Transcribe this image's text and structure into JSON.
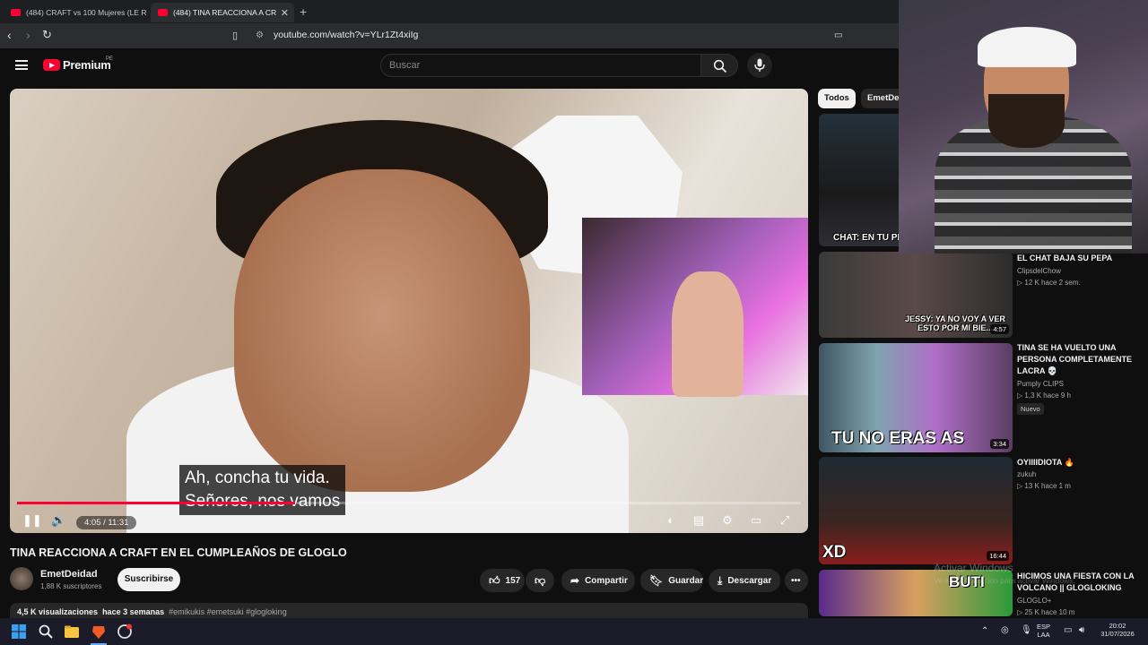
{
  "browser": {
    "tabs": [
      {
        "label": "(484) CRAFT vs 100 Mujeres (LE ROBO"
      },
      {
        "label": "(484) TINA REACCIONA A CR"
      }
    ],
    "new_tab": "+",
    "url": "youtube.com/watch?v=YLr1Zt4xiIg"
  },
  "youtube": {
    "brand": "Premium",
    "region": "PE",
    "search_placeholder": "Buscar"
  },
  "player": {
    "caption_line1": "Ah, concha tu vida.",
    "caption_line2": "Señores, nos vamos",
    "time": "4:05 / 11:31",
    "progress_fraction": 0.355
  },
  "video": {
    "title": "TINA REACCIONA A CRAFT EN EL CUMPLEAÑOS DE GLOGLO",
    "channel": "EmetDeidad",
    "subscribers": "1,88 K suscriptores",
    "subscribe_label": "Suscribirse",
    "likes": "157",
    "share_label": "Compartir",
    "save_label": "Guardar",
    "download_label": "Descargar",
    "views": "4,5 K visualizaciones",
    "age": "hace 3 semanas",
    "tags": "#emikukis #emetsuki #glogloking"
  },
  "chips": [
    "Todos",
    "EmetDei"
  ],
  "recommendations": [
    {
      "thumb_text": "CHAT: EN TU PE"
    },
    {
      "title": "EL CHAT BAJA SU PEPA",
      "channel": "ClipsdelChow",
      "meta": "▷ 12 K  hace 2 sem.",
      "duration": "4:57",
      "thumb_text": "JESSY: YA NO VOY A VER ESTO POR MI BIE..."
    },
    {
      "title": "TINA SE HA VUELTO UNA PERSONA COMPLETAMENTE LACRA 💀",
      "channel": "Pumply CLIPS",
      "meta": "▷ 1,3 K  hace 9 h",
      "badge": "Nuevo",
      "duration": "3:34",
      "thumb_text": "TU NO ERAS AS"
    },
    {
      "title": "OYIIIIDIOTA 🔥",
      "channel": "zukuh",
      "meta": "▷ 13 K  hace 1 m",
      "duration": "16:44",
      "thumb_text": "XD"
    },
    {
      "title": "HICIMOS UNA FIESTA CON LA VOLCANO || GLOGLOKING",
      "channel": "GLOGLO+",
      "meta": "▷ 25 K  hace 10 m",
      "thumb_text": "BUTI"
    }
  ],
  "watermark": {
    "line1": "Activar Windows",
    "line2": "Ve a Configuración para activar Windows."
  },
  "taskbar": {
    "lang": "ESP",
    "lang2": "LAA",
    "time": "20:02",
    "date": "31/07/2026"
  },
  "colors": {
    "accent": "#ff0033",
    "background": "#0f0f0f",
    "pill": "#272727"
  }
}
